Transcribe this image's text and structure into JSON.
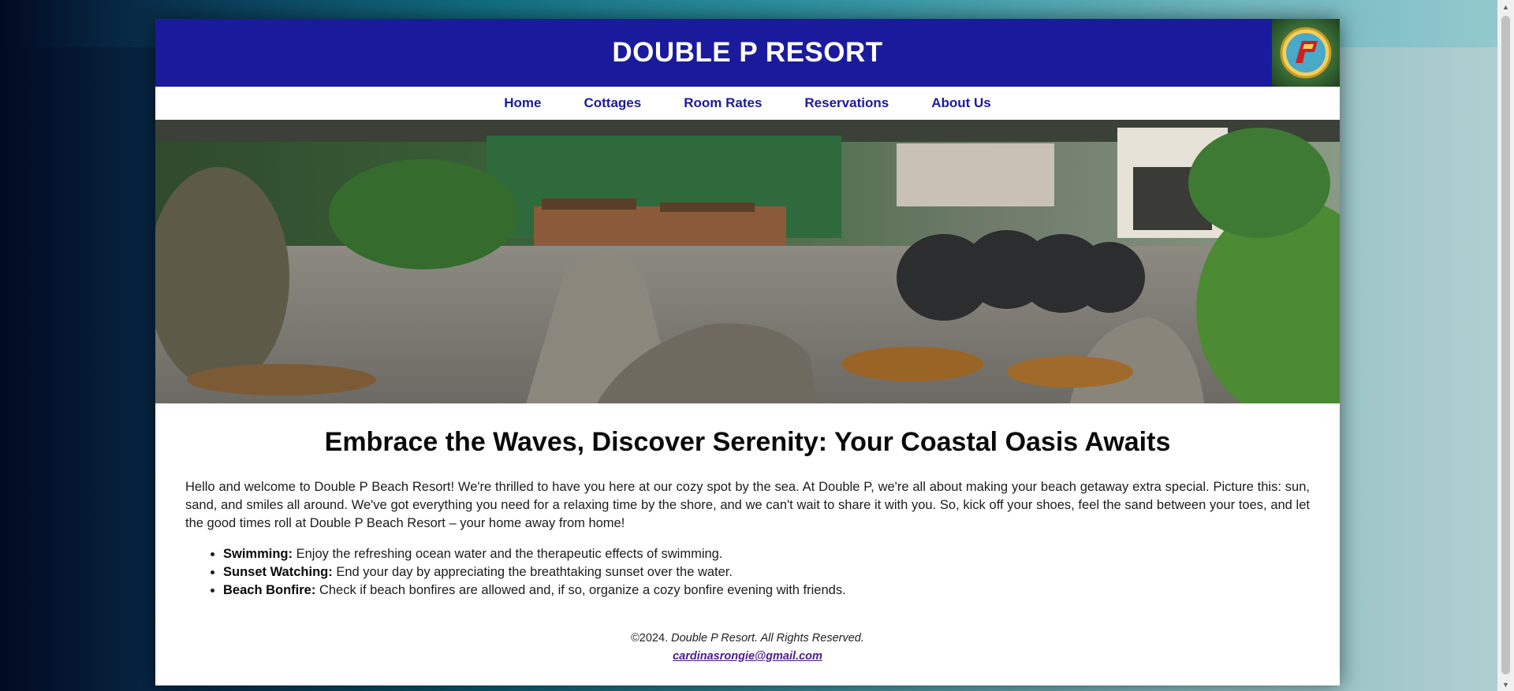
{
  "site": {
    "title": "DOUBLE P RESORT"
  },
  "nav": [
    {
      "label": "Home"
    },
    {
      "label": "Cottages"
    },
    {
      "label": "Room Rates"
    },
    {
      "label": "Reservations"
    },
    {
      "label": "About Us"
    }
  ],
  "hero": {
    "description": "resort garden with rocks, tables and stacked chairs"
  },
  "main": {
    "headline": "Embrace the Waves, Discover Serenity: Your Coastal Oasis Awaits",
    "intro": "Hello and welcome to Double P Beach Resort! We're thrilled to have you here at our cozy spot by the sea. At Double P, we're all about making your beach getaway extra special. Picture this: sun, sand, and smiles all around. We've got everything you need for a relaxing time by the shore, and we can't wait to share it with you. So, kick off your shoes, feel the sand between your toes, and let the good times roll at Double P Beach Resort – your home away from home!",
    "features": [
      {
        "title": "Swimming:",
        "text": "Enjoy the refreshing ocean water and the therapeutic effects of swimming."
      },
      {
        "title": "Sunset Watching:",
        "text": "End your day by appreciating the breathtaking sunset over the water."
      },
      {
        "title": "Beach Bonfire:",
        "text": "Check if beach bonfires are allowed and, if so, organize a cozy bonfire evening with friends."
      }
    ]
  },
  "footer": {
    "copyright": "©2024.",
    "rights": "Double P Resort. All Rights Reserved.",
    "email": "cardinasrongie@gmail.com"
  },
  "colors": {
    "header_bg": "#1a1b9c",
    "nav_text": "#1a1b9c",
    "link": "#4a1c8c"
  },
  "icons": {
    "logo": "resort-logo-icon"
  }
}
